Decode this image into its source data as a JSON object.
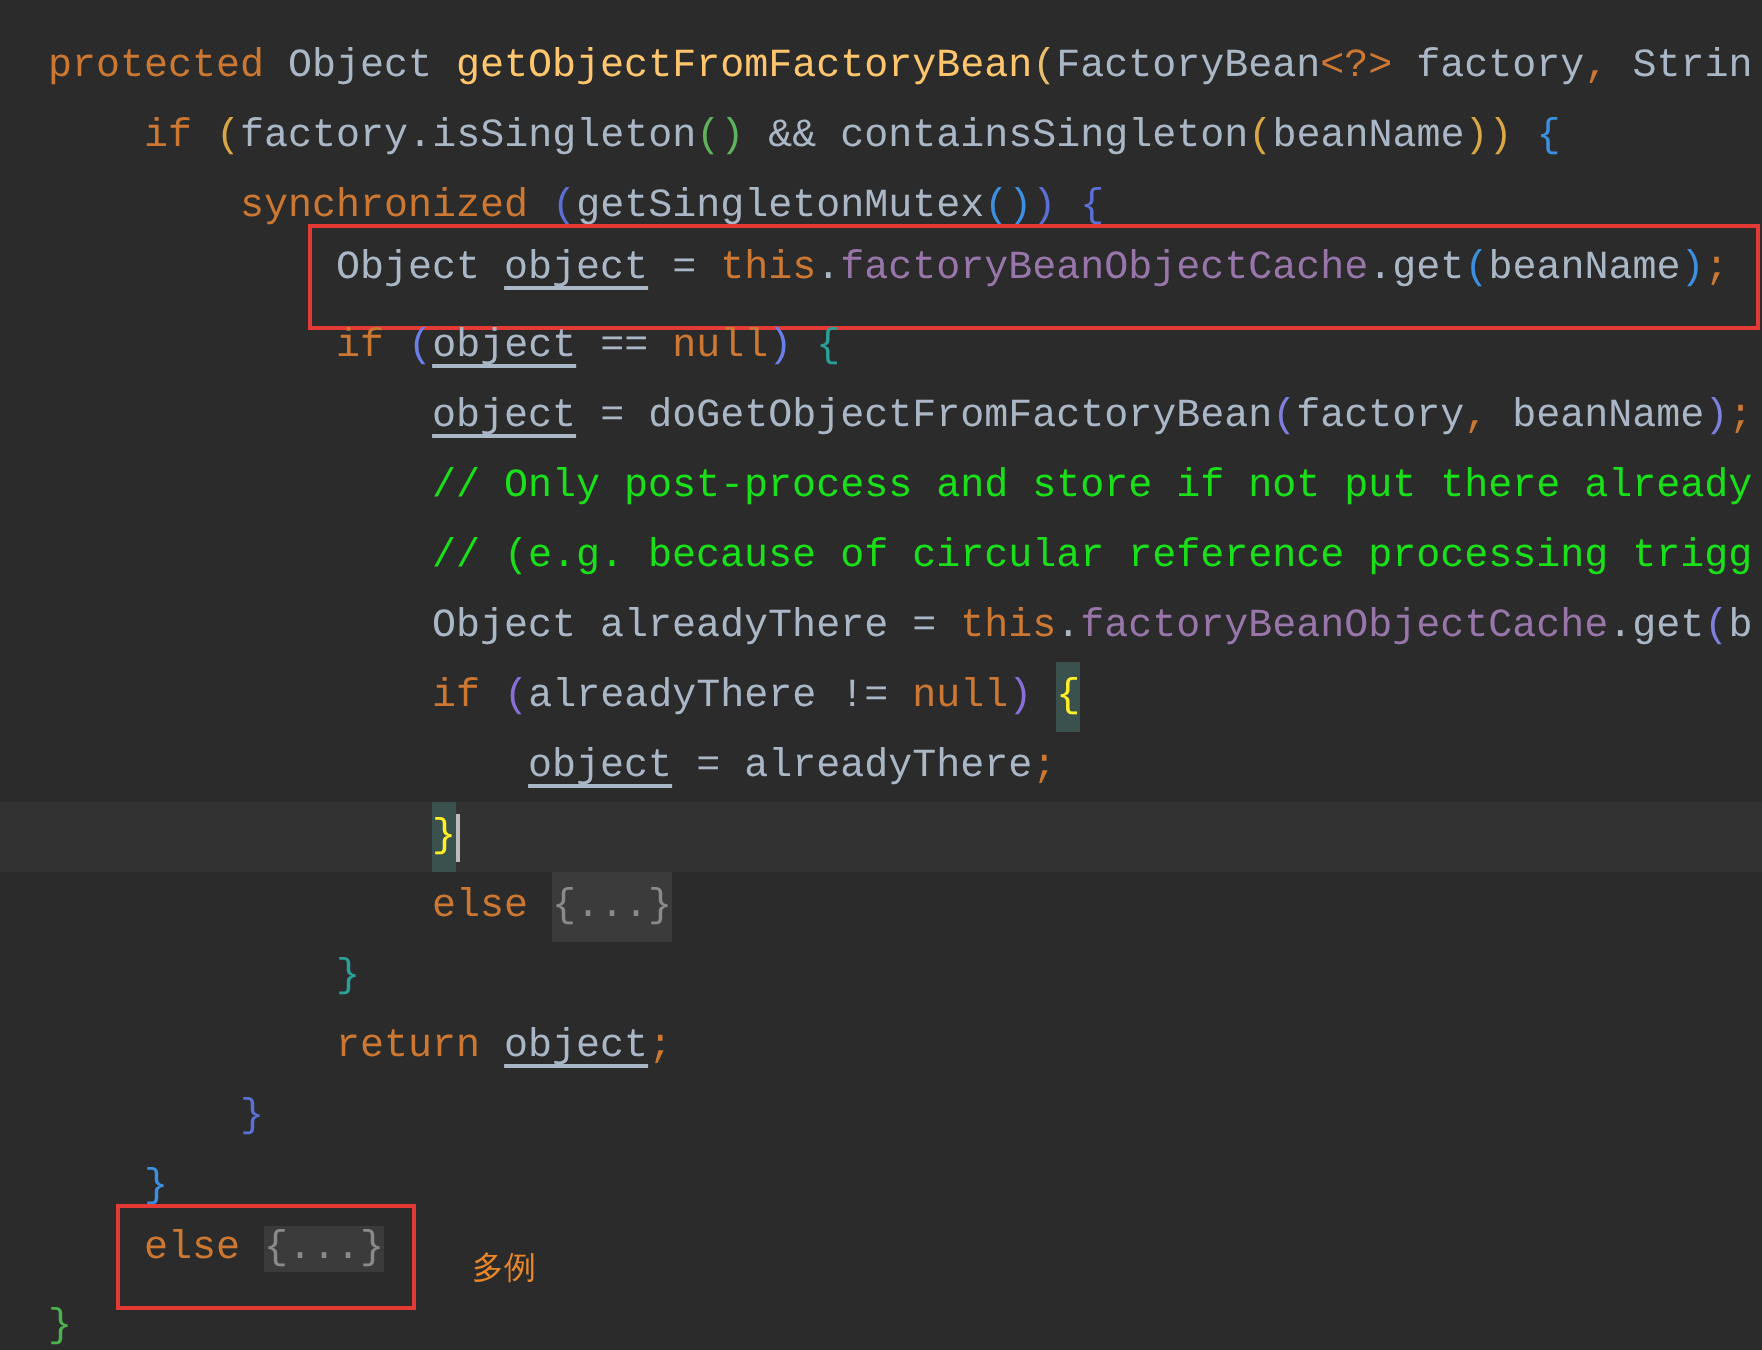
{
  "code_lines": [
    {
      "current": false,
      "boxed": false,
      "tokens": [
        {
          "kind": "keyword",
          "text": "protected "
        },
        {
          "kind": "plain",
          "text": "Object "
        },
        {
          "kind": "method",
          "text": "getObjectFromFactoryBean"
        },
        {
          "kind": "bracket",
          "text": "(",
          "color": "#e8bf6a"
        },
        {
          "kind": "plain",
          "text": "FactoryBean"
        },
        {
          "kind": "keyword",
          "text": "<?>"
        },
        {
          "kind": "plain",
          "text": " factory"
        },
        {
          "kind": "keyword",
          "text": ", "
        },
        {
          "kind": "plain",
          "text": "Strin"
        }
      ]
    },
    {
      "current": false,
      "boxed": false,
      "tokens": [
        {
          "kind": "keyword",
          "text": "    if "
        },
        {
          "kind": "bracket",
          "text": "(",
          "color": "#d9a745"
        },
        {
          "kind": "plain",
          "text": "factory.isSingleton"
        },
        {
          "kind": "bracket",
          "text": "()",
          "color": "#5fb35f"
        },
        {
          "kind": "plain",
          "text": " && containsSingleton"
        },
        {
          "kind": "bracket",
          "text": "(",
          "color": "#d9a745"
        },
        {
          "kind": "plain",
          "text": "beanName"
        },
        {
          "kind": "bracket",
          "text": ")",
          "color": "#d9a745"
        },
        {
          "kind": "bracket",
          "text": ")",
          "color": "#d9a745"
        },
        {
          "kind": "bracket",
          "text": " {",
          "color": "#3d8fe0"
        }
      ]
    },
    {
      "current": false,
      "boxed": false,
      "tokens": [
        {
          "kind": "keyword",
          "text": "        synchronized "
        },
        {
          "kind": "bracket",
          "text": "(",
          "color": "#5b6fd4"
        },
        {
          "kind": "plain",
          "text": "getSingletonMutex"
        },
        {
          "kind": "bracket",
          "text": "()",
          "color": "#3d8fe0"
        },
        {
          "kind": "bracket",
          "text": ")",
          "color": "#5b6fd4"
        },
        {
          "kind": "bracket",
          "text": " {",
          "color": "#5b6fd4"
        }
      ]
    },
    {
      "current": false,
      "boxed": true,
      "tokens": [
        {
          "kind": "plain",
          "text": "            Object "
        },
        {
          "kind": "local",
          "text": "object"
        },
        {
          "kind": "plain",
          "text": " = "
        },
        {
          "kind": "keyword",
          "text": "this"
        },
        {
          "kind": "plain",
          "text": "."
        },
        {
          "kind": "field",
          "text": "factoryBeanObjectCache"
        },
        {
          "kind": "plain",
          "text": ".get"
        },
        {
          "kind": "bracket",
          "text": "(",
          "color": "#3d8fe0"
        },
        {
          "kind": "plain",
          "text": "beanName"
        },
        {
          "kind": "bracket",
          "text": ")",
          "color": "#3d8fe0"
        },
        {
          "kind": "keyword",
          "text": ";"
        }
      ]
    },
    {
      "current": false,
      "boxed": false,
      "tokens": [
        {
          "kind": "keyword",
          "text": "            if "
        },
        {
          "kind": "bracket",
          "text": "(",
          "color": "#6a7fe8"
        },
        {
          "kind": "local",
          "text": "object"
        },
        {
          "kind": "plain",
          "text": " == "
        },
        {
          "kind": "keyword",
          "text": "null"
        },
        {
          "kind": "bracket",
          "text": ")",
          "color": "#6a7fe8"
        },
        {
          "kind": "bracket",
          "text": " {",
          "color": "#2aa198"
        }
      ]
    },
    {
      "current": false,
      "boxed": false,
      "tokens": [
        {
          "kind": "local",
          "text": "                object"
        },
        {
          "kind": "plain",
          "text": " = doGetObjectFromFactoryBean"
        },
        {
          "kind": "bracket",
          "text": "(",
          "color": "#7f7fe0"
        },
        {
          "kind": "plain",
          "text": "factory"
        },
        {
          "kind": "keyword",
          "text": ", "
        },
        {
          "kind": "plain",
          "text": "beanName"
        },
        {
          "kind": "bracket",
          "text": ")",
          "color": "#7f7fe0"
        },
        {
          "kind": "keyword",
          "text": ";"
        }
      ]
    },
    {
      "current": false,
      "boxed": false,
      "tokens": [
        {
          "kind": "comment",
          "text": "                // Only post-process and store if not put there already"
        }
      ]
    },
    {
      "current": false,
      "boxed": false,
      "tokens": [
        {
          "kind": "comment",
          "text": "                // (e.g. because of circular reference processing trigg"
        }
      ]
    },
    {
      "current": false,
      "boxed": false,
      "tokens": [
        {
          "kind": "plain",
          "text": "                Object alreadyThere = "
        },
        {
          "kind": "keyword",
          "text": "this"
        },
        {
          "kind": "plain",
          "text": "."
        },
        {
          "kind": "field",
          "text": "factoryBeanObjectCache"
        },
        {
          "kind": "plain",
          "text": ".get"
        },
        {
          "kind": "bracket",
          "text": "(",
          "color": "#7f7fe0"
        },
        {
          "kind": "plain",
          "text": "b"
        }
      ]
    },
    {
      "current": false,
      "boxed": false,
      "tokens": [
        {
          "kind": "keyword",
          "text": "                if "
        },
        {
          "kind": "bracket",
          "text": "(",
          "color": "#8a6fd8"
        },
        {
          "kind": "plain",
          "text": "alreadyThere != "
        },
        {
          "kind": "keyword",
          "text": "null"
        },
        {
          "kind": "bracket",
          "text": ")",
          "color": "#8a6fd8"
        },
        {
          "kind": "matched",
          "text": " {"
        }
      ]
    },
    {
      "current": false,
      "boxed": false,
      "tokens": [
        {
          "kind": "local",
          "text": "                    object"
        },
        {
          "kind": "plain",
          "text": " = alreadyThere"
        },
        {
          "kind": "keyword",
          "text": ";"
        }
      ]
    },
    {
      "current": true,
      "boxed": false,
      "tokens": [
        {
          "kind": "matched",
          "text": "                }"
        }
      ]
    },
    {
      "current": false,
      "boxed": false,
      "tokens": [
        {
          "kind": "keyword",
          "text": "                else "
        },
        {
          "kind": "fold",
          "text": "{...}"
        }
      ]
    },
    {
      "current": false,
      "boxed": false,
      "tokens": [
        {
          "kind": "bracket",
          "text": "            }",
          "color": "#2aa198"
        }
      ]
    },
    {
      "current": false,
      "boxed": false,
      "tokens": [
        {
          "kind": "keyword",
          "text": "            return "
        },
        {
          "kind": "local",
          "text": "object"
        },
        {
          "kind": "keyword",
          "text": ";"
        }
      ]
    },
    {
      "current": false,
      "boxed": false,
      "tokens": [
        {
          "kind": "bracket",
          "text": "        }",
          "color": "#5b6fd4"
        }
      ]
    },
    {
      "current": false,
      "boxed": false,
      "tokens": [
        {
          "kind": "bracket",
          "text": "    }",
          "color": "#3d8fe0"
        }
      ]
    },
    {
      "current": false,
      "boxed": true,
      "note": "多例",
      "tokens": [
        {
          "kind": "keyword",
          "text": "    else "
        },
        {
          "kind": "fold",
          "text": "{...}"
        }
      ]
    },
    {
      "current": false,
      "boxed": false,
      "tokens": [
        {
          "kind": "bracket",
          "text": "}",
          "color": "#4caf50"
        }
      ]
    }
  ]
}
